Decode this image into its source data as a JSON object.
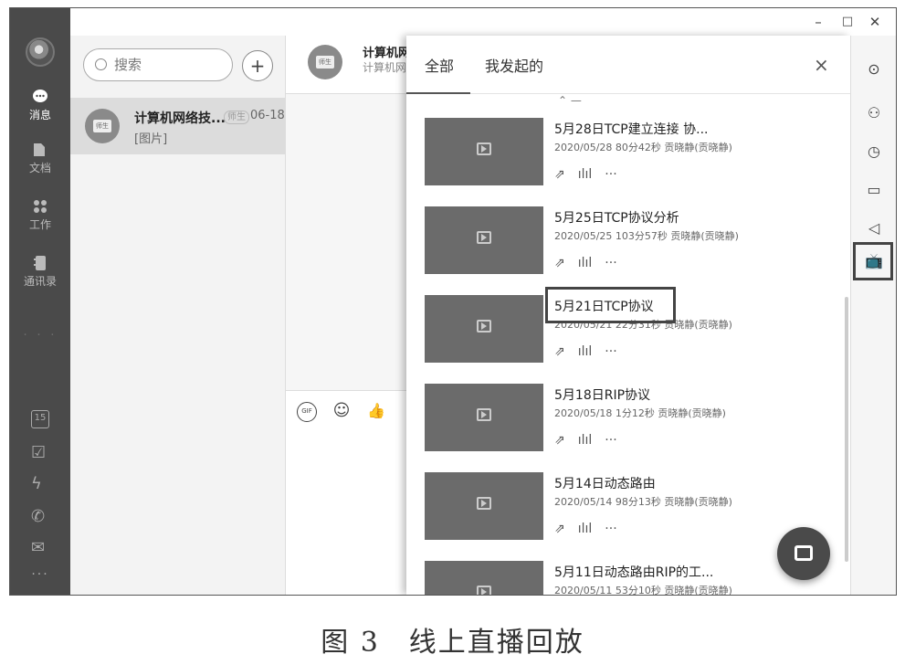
{
  "window": {
    "minimize": "–",
    "maximize": "□",
    "close": "✕"
  },
  "rail": {
    "items": [
      {
        "label": "消息",
        "icon": "chat-bubble-icon"
      },
      {
        "label": "文档",
        "icon": "document-icon"
      },
      {
        "label": "工作",
        "icon": "grid-icon"
      },
      {
        "label": "通讯录",
        "icon": "contacts-icon"
      }
    ],
    "bottom": [
      {
        "icon": "calendar-icon",
        "glyph": "15"
      },
      {
        "icon": "checkbox-icon",
        "glyph": "☑"
      },
      {
        "icon": "lightning-icon",
        "glyph": "ϟ"
      },
      {
        "icon": "phone-icon",
        "glyph": "✆"
      },
      {
        "icon": "mail-icon",
        "glyph": "✉"
      }
    ],
    "more": "···"
  },
  "search": {
    "placeholder": "搜索",
    "add": "+"
  },
  "conversation": {
    "avatar_text": "师生",
    "name": "计算机网络技...",
    "tag": "师生",
    "time": "06-18",
    "preview": "[图片]"
  },
  "chat": {
    "avatar_text": "师生",
    "name": "计算机网",
    "subtitle": "计算机网",
    "input_icons": [
      "GIF",
      "☺",
      "👍"
    ]
  },
  "panel": {
    "tabs": [
      "全部",
      "我发起的"
    ],
    "close": "×",
    "stub": "⌃ —",
    "items": [
      {
        "title": "5月28日TCP建立连接 协...",
        "meta": "2020/05/28 80分42秒 贡晓静(贡晓静)"
      },
      {
        "title": "5月25日TCP协议分析",
        "meta": "2020/05/25 103分57秒 贡晓静(贡晓静)"
      },
      {
        "title": "5月21日TCP协议",
        "meta": "2020/05/21 22分31秒 贡晓静(贡晓静)"
      },
      {
        "title": "5月18日RIP协议",
        "meta": "2020/05/18 1分12秒 贡晓静(贡晓静)"
      },
      {
        "title": "5月14日动态路由",
        "meta": "2020/05/14 98分13秒 贡晓静(贡晓静)"
      },
      {
        "title": "5月11日动态路由RIP的工...",
        "meta": "2020/05/11 53分10秒 贡晓静(贡晓静)"
      }
    ],
    "actions": {
      "share": "⇗",
      "stats": "ılıl",
      "more": "···"
    }
  },
  "right_bar": [
    {
      "icon": "more-circle-icon",
      "glyph": "⊙"
    },
    {
      "icon": "add-member-icon",
      "glyph": "⚇"
    },
    {
      "icon": "history-clock-icon",
      "glyph": "◷"
    },
    {
      "icon": "folder-icon",
      "glyph": "▭"
    },
    {
      "icon": "announcement-icon",
      "glyph": "◁"
    },
    {
      "icon": "live-tv-icon",
      "glyph": "📺"
    }
  ],
  "caption": "图 3　线上直播回放"
}
